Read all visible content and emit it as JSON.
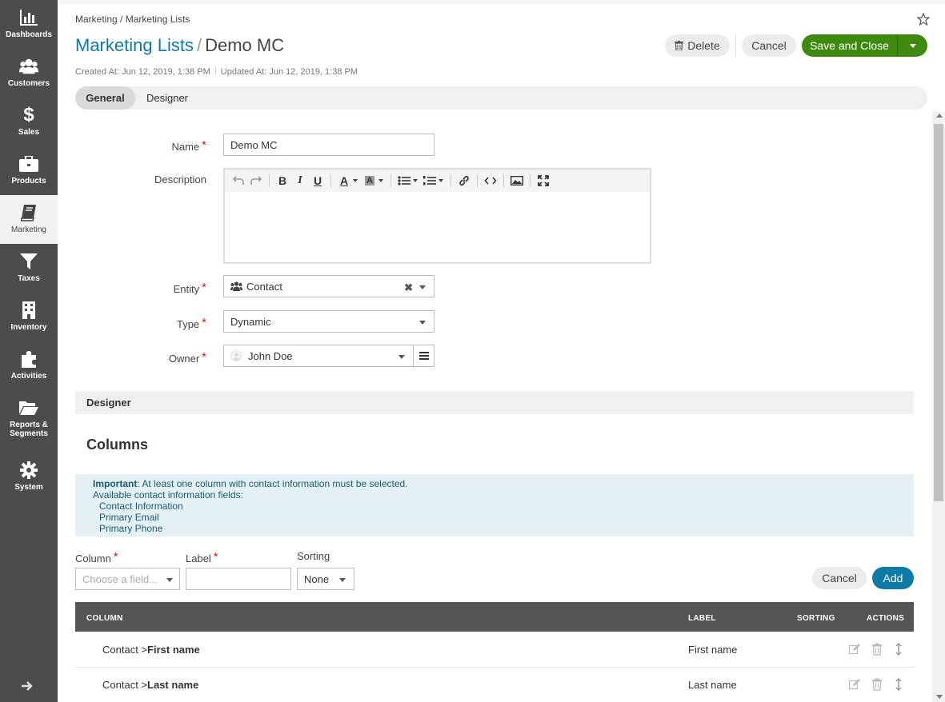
{
  "sidebar": {
    "items": [
      {
        "label": "Dashboards",
        "icon": "bar-chart-icon"
      },
      {
        "label": "Customers",
        "icon": "users-icon"
      },
      {
        "label": "Sales",
        "icon": "dollar-icon"
      },
      {
        "label": "Products",
        "icon": "briefcase-icon"
      },
      {
        "label": "Marketing",
        "icon": "book-icon"
      },
      {
        "label": "Taxes",
        "icon": "filter-icon"
      },
      {
        "label": "Inventory",
        "icon": "building-icon"
      },
      {
        "label": "Activities",
        "icon": "puzzle-icon"
      },
      {
        "label": "Reports & Segments",
        "icon": "folder-icon"
      },
      {
        "label": "System",
        "icon": "gear-icon"
      }
    ]
  },
  "breadcrumb": {
    "first": "Marketing",
    "sep": "/",
    "second": "Marketing Lists"
  },
  "title": {
    "entity": "Marketing Lists",
    "sep": "/",
    "record": "Demo MC"
  },
  "meta": {
    "created": "Created At: Jun 12, 2019, 1:38 PM",
    "updated": "Updated At: Jun 12, 2019, 1:38 PM"
  },
  "actions": {
    "delete": "Delete",
    "cancel": "Cancel",
    "save": "Save and Close"
  },
  "tabs": {
    "general": "General",
    "designer": "Designer"
  },
  "form": {
    "name_label": "Name",
    "name_value": "Demo MC",
    "description_label": "Description",
    "entity_label": "Entity",
    "entity_value": "Contact",
    "type_label": "Type",
    "type_value": "Dynamic",
    "owner_label": "Owner",
    "owner_value": "John Doe",
    "required_mark": "*"
  },
  "designer": {
    "section": "Designer",
    "columns_title": "Columns",
    "info": {
      "important": "Important",
      "text": ": At least one column with contact information must be selected.",
      "available": "Available contact information fields:",
      "fields": [
        "Contact Information",
        "Primary Email",
        "Primary Phone"
      ]
    },
    "column_label": "Column",
    "column_placeholder": "Choose a field...",
    "label_label": "Label",
    "sorting_label": "Sorting",
    "sorting_value": "None",
    "cancel": "Cancel",
    "add": "Add",
    "table": {
      "headers": {
        "column": "COLUMN",
        "label": "LABEL",
        "sorting": "SORTING",
        "actions": "ACTIONS"
      },
      "rows": [
        {
          "prefix": "Contact",
          "arrow": ">",
          "field": "First name",
          "label": "First name"
        },
        {
          "prefix": "Contact",
          "arrow": ">",
          "field": "Last name",
          "label": "Last name"
        }
      ]
    }
  }
}
